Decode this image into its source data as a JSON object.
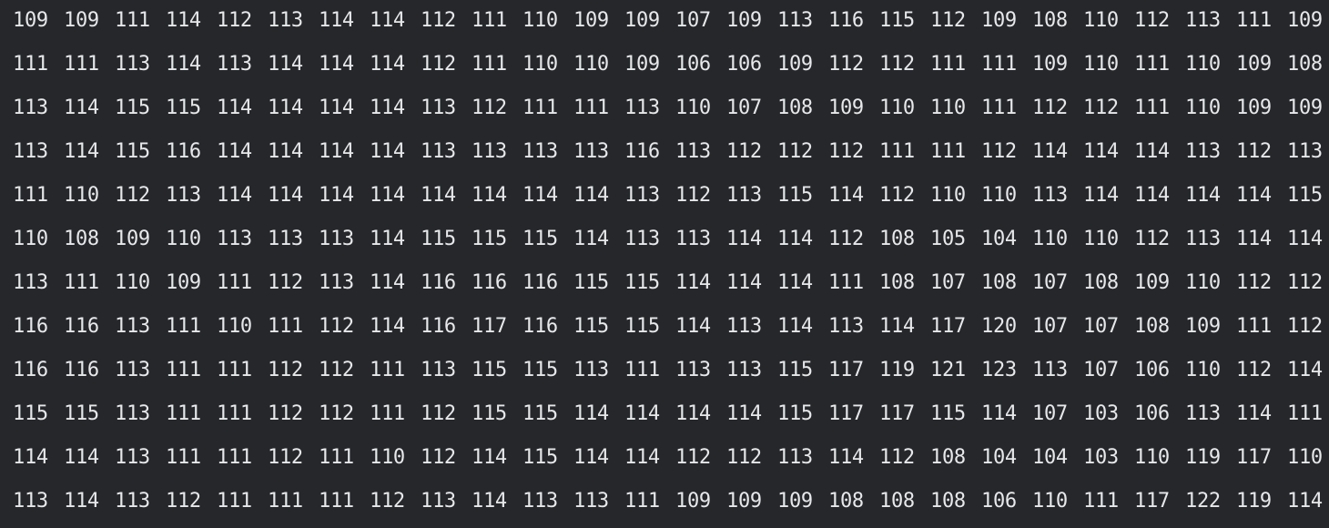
{
  "grid": {
    "rows": [
      [
        "109",
        "109",
        "111",
        "114",
        "112",
        "113",
        "114",
        "114",
        "112",
        "111",
        "110",
        "109",
        "109",
        "107",
        "109",
        "113",
        "116",
        "115",
        "112",
        "109",
        "108",
        "110",
        "112",
        "113",
        "111",
        "109"
      ],
      [
        "111",
        "111",
        "113",
        "114",
        "113",
        "114",
        "114",
        "114",
        "112",
        "111",
        "110",
        "110",
        "109",
        "106",
        "106",
        "109",
        "112",
        "112",
        "111",
        "111",
        "109",
        "110",
        "111",
        "110",
        "109",
        "108"
      ],
      [
        "113",
        "114",
        "115",
        "115",
        "114",
        "114",
        "114",
        "114",
        "113",
        "112",
        "111",
        "111",
        "113",
        "110",
        "107",
        "108",
        "109",
        "110",
        "110",
        "111",
        "112",
        "112",
        "111",
        "110",
        "109",
        "109"
      ],
      [
        "113",
        "114",
        "115",
        "116",
        "114",
        "114",
        "114",
        "114",
        "113",
        "113",
        "113",
        "113",
        "116",
        "113",
        "112",
        "112",
        "112",
        "111",
        "111",
        "112",
        "114",
        "114",
        "114",
        "113",
        "112",
        "113"
      ],
      [
        "111",
        "110",
        "112",
        "113",
        "114",
        "114",
        "114",
        "114",
        "114",
        "114",
        "114",
        "114",
        "113",
        "112",
        "113",
        "115",
        "114",
        "112",
        "110",
        "110",
        "113",
        "114",
        "114",
        "114",
        "114",
        "115"
      ],
      [
        "110",
        "108",
        "109",
        "110",
        "113",
        "113",
        "113",
        "114",
        "115",
        "115",
        "115",
        "114",
        "113",
        "113",
        "114",
        "114",
        "112",
        "108",
        "105",
        "104",
        "110",
        "110",
        "112",
        "113",
        "114",
        "114"
      ],
      [
        "113",
        "111",
        "110",
        "109",
        "111",
        "112",
        "113",
        "114",
        "116",
        "116",
        "116",
        "115",
        "115",
        "114",
        "114",
        "114",
        "111",
        "108",
        "107",
        "108",
        "107",
        "108",
        "109",
        "110",
        "112",
        "112"
      ],
      [
        "116",
        "116",
        "113",
        "111",
        "110",
        "111",
        "112",
        "114",
        "116",
        "117",
        "116",
        "115",
        "115",
        "114",
        "113",
        "114",
        "113",
        "114",
        "117",
        "120",
        "107",
        "107",
        "108",
        "109",
        "111",
        "112"
      ],
      [
        "116",
        "116",
        "113",
        "111",
        "111",
        "112",
        "112",
        "111",
        "113",
        "115",
        "115",
        "113",
        "111",
        "113",
        "113",
        "115",
        "117",
        "119",
        "121",
        "123",
        "113",
        "107",
        "106",
        "110",
        "112",
        "114"
      ],
      [
        "115",
        "115",
        "113",
        "111",
        "111",
        "112",
        "112",
        "111",
        "112",
        "115",
        "115",
        "114",
        "114",
        "114",
        "114",
        "115",
        "117",
        "117",
        "115",
        "114",
        "107",
        "103",
        "106",
        "113",
        "114",
        "111"
      ],
      [
        "114",
        "114",
        "113",
        "111",
        "111",
        "112",
        "111",
        "110",
        "112",
        "114",
        "115",
        "114",
        "114",
        "112",
        "112",
        "113",
        "114",
        "112",
        "108",
        "104",
        "104",
        "103",
        "110",
        "119",
        "117",
        "110"
      ],
      [
        "113",
        "114",
        "113",
        "112",
        "111",
        "111",
        "111",
        "112",
        "113",
        "114",
        "113",
        "113",
        "111",
        "109",
        "109",
        "109",
        "108",
        "108",
        "108",
        "106",
        "110",
        "111",
        "117",
        "122",
        "119",
        "114"
      ]
    ]
  },
  "colors": {
    "background": "#25272b",
    "text": "#e6e8ea"
  }
}
